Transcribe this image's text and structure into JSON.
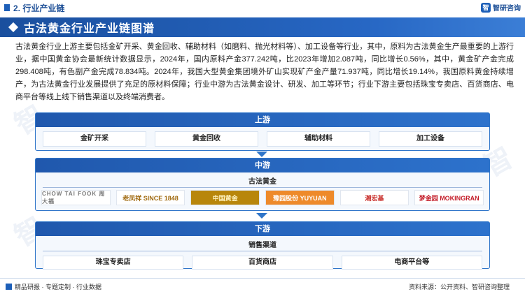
{
  "header": {
    "section_label": "2. 行业产业链",
    "logo_text": "智研咨询",
    "logo_mark": "智"
  },
  "title": "古法黄金行业产业链图谱",
  "paragraph": "古法黄金行业上游主要包括金矿开采、黄金回收、辅助材料（如磨料、抛光材料等）、加工设备等行业，其中，原料为古法黄金生产最重要的上游行业，据中国黄金协会最新统计数据显示，2024年，国内原料产金377.242吨，比2023年增加2.087吨，同比增长0.56%，其中，黄金矿产金完成298.408吨，有色副产金完成78.834吨。2024年，我国大型黄金集团境外矿山实现矿产金产量71.937吨，同比增长19.14%，我国原料黄金持续增产，为古法黄金行业发展提供了充足的原材料保障；行业中游为古法黄金设计、研发、加工等环节；行业下游主要包括珠宝专卖店、百货商店、电商平台等线上线下销售渠道以及终端消费者。",
  "upstream": {
    "label": "上游",
    "items": [
      "金矿开采",
      "黄金回收",
      "辅助材料",
      "加工设备"
    ]
  },
  "midstream": {
    "label": "中游",
    "subtitle": "古法黄金",
    "brands": [
      "CHOW TAI FOOK 周大福",
      "老凤祥 SINCE 1848",
      "中国黄金",
      "豫园股份 YUYUAN",
      "潮宏基",
      "梦金园 MOKINGRAN"
    ]
  },
  "downstream": {
    "label": "下游",
    "subtitle": "销售渠道",
    "items": [
      "珠宝专卖店",
      "百货商店",
      "电商平台等"
    ]
  },
  "footer": {
    "left": "精品研报 · 专题定制 · 行业数据",
    "right": "资料来源：公开资料、智研咨询整理"
  }
}
